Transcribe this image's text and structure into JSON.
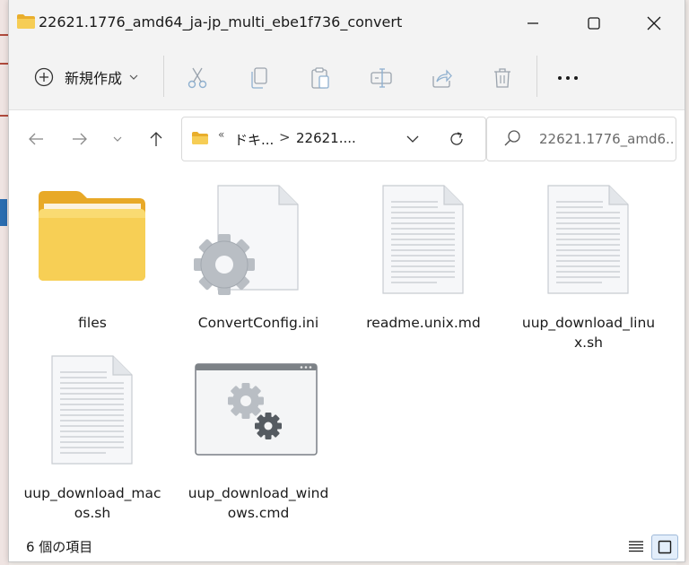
{
  "window": {
    "title": "22621.1776_amd64_ja-jp_multi_ebe1f736_convert"
  },
  "commandbar": {
    "new_label": "新規作成",
    "icons": [
      "cut-icon",
      "copy-icon",
      "paste-icon",
      "rename-icon",
      "share-icon",
      "delete-icon",
      "more-icon"
    ]
  },
  "address": {
    "overflow": "«",
    "crumb1": "ドキ...",
    "separator": ">",
    "crumb2": "22621...."
  },
  "search": {
    "placeholder": "22621.1776_amd6..."
  },
  "files": [
    {
      "name": "files",
      "type": "folder"
    },
    {
      "name": "ConvertConfig.ini",
      "type": "config"
    },
    {
      "name": "readme.unix.md",
      "type": "text"
    },
    {
      "name": "uup_download_linux.sh",
      "type": "text"
    },
    {
      "name": "uup_download_macos.sh",
      "type": "text"
    },
    {
      "name": "uup_download_windows.cmd",
      "type": "cmd"
    }
  ],
  "status": {
    "count_text": "6 個の項目"
  },
  "colors": {
    "folder_yellow": "#f4c542",
    "accent": "#0067c0",
    "titlebar_bg": "#f3f3f3"
  }
}
